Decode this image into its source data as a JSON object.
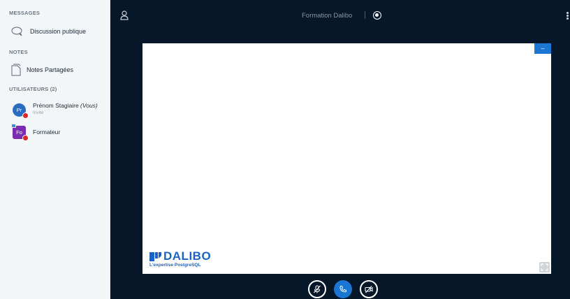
{
  "sidebar": {
    "messages_title": "MESSAGES",
    "public_chat_label": "Discussion publique",
    "notes_title": "NOTES",
    "shared_notes_label": "Notes Partagées",
    "users_title": "UTILISATEURS (2)",
    "users": [
      {
        "initials": "Pr",
        "name": "Prénom Stagiaire",
        "you_suffix": "(Vous)",
        "role": "Invité",
        "avatar_color": "#2a6cc2"
      },
      {
        "initials": "Fo",
        "name": "Formateur",
        "avatar_color": "#7b2cb0"
      }
    ]
  },
  "main": {
    "meeting_title": "Formation Dalibo",
    "minimize_label": "–",
    "logo_text": "DALIBO",
    "logo_tagline": "L'expertise PostgreSQL"
  },
  "controls": [
    "microphone-muted",
    "phone-audio",
    "camera-off"
  ],
  "colors": {
    "primary": "#1b76d3",
    "background": "#06172a",
    "danger": "#df2721",
    "brand": "#1b63c2"
  }
}
